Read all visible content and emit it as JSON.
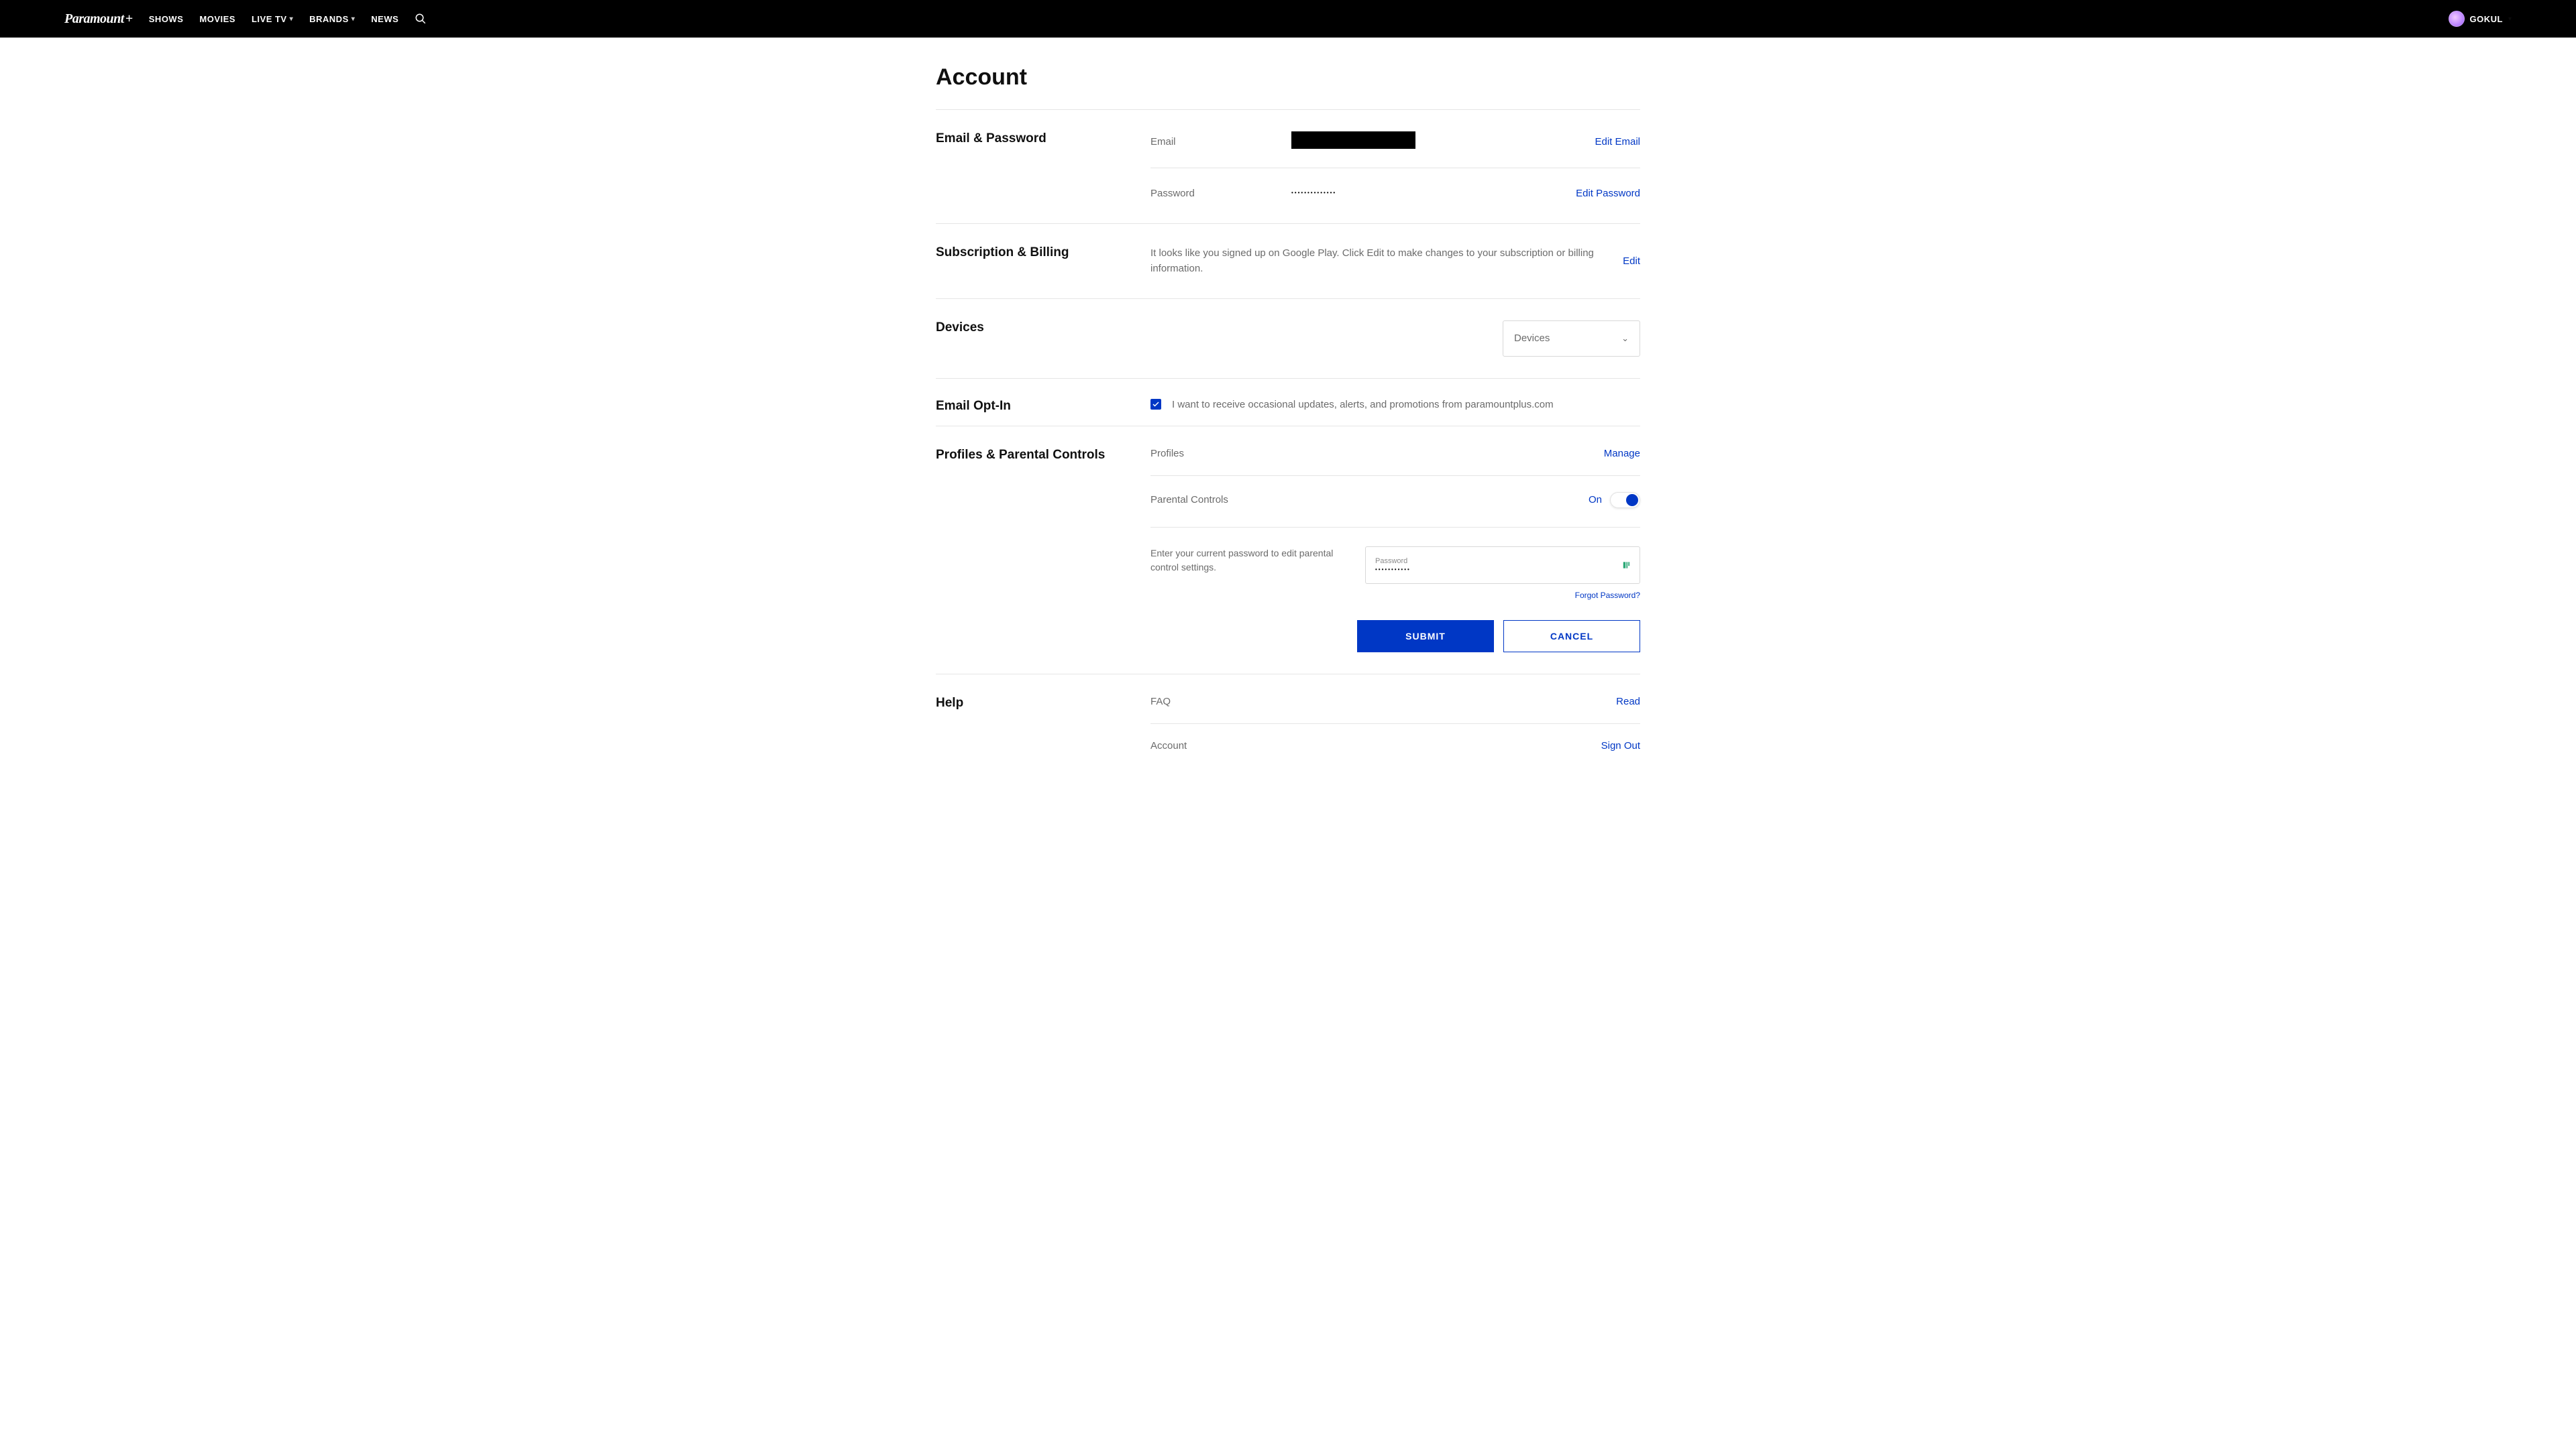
{
  "header": {
    "nav": {
      "shows": "SHOWS",
      "movies": "MOVIES",
      "livetv": "LIVE TV",
      "brands": "BRANDS",
      "news": "NEWS"
    },
    "username": "GOKUL"
  },
  "page": {
    "title": "Account"
  },
  "email_password": {
    "title": "Email & Password",
    "email_label": "Email",
    "edit_email": "Edit Email",
    "password_label": "Password",
    "password_value": "••••••••••••••",
    "edit_password": "Edit Password"
  },
  "subscription": {
    "title": "Subscription & Billing",
    "text": "It looks like you signed up on Google Play. Click Edit to make changes to your subscription or billing information.",
    "edit": "Edit"
  },
  "devices": {
    "title": "Devices",
    "dropdown_label": "Devices"
  },
  "optin": {
    "title": "Email Opt-In",
    "label": "I want to receive occasional updates, alerts, and promotions from paramountplus.com"
  },
  "profiles": {
    "title": "Profiles & Parental Controls",
    "profiles_label": "Profiles",
    "manage": "Manage",
    "parental_label": "Parental Controls",
    "toggle_state": "On",
    "pw_instruct": "Enter your current password to edit parental control settings.",
    "pw_field_label": "Password",
    "pw_field_value": "•••••••••••",
    "forgot": "Forgot Password?",
    "submit": "SUBMIT",
    "cancel": "CANCEL"
  },
  "help": {
    "title": "Help",
    "faq_label": "FAQ",
    "read": "Read",
    "account_label": "Account",
    "signout": "Sign Out"
  }
}
